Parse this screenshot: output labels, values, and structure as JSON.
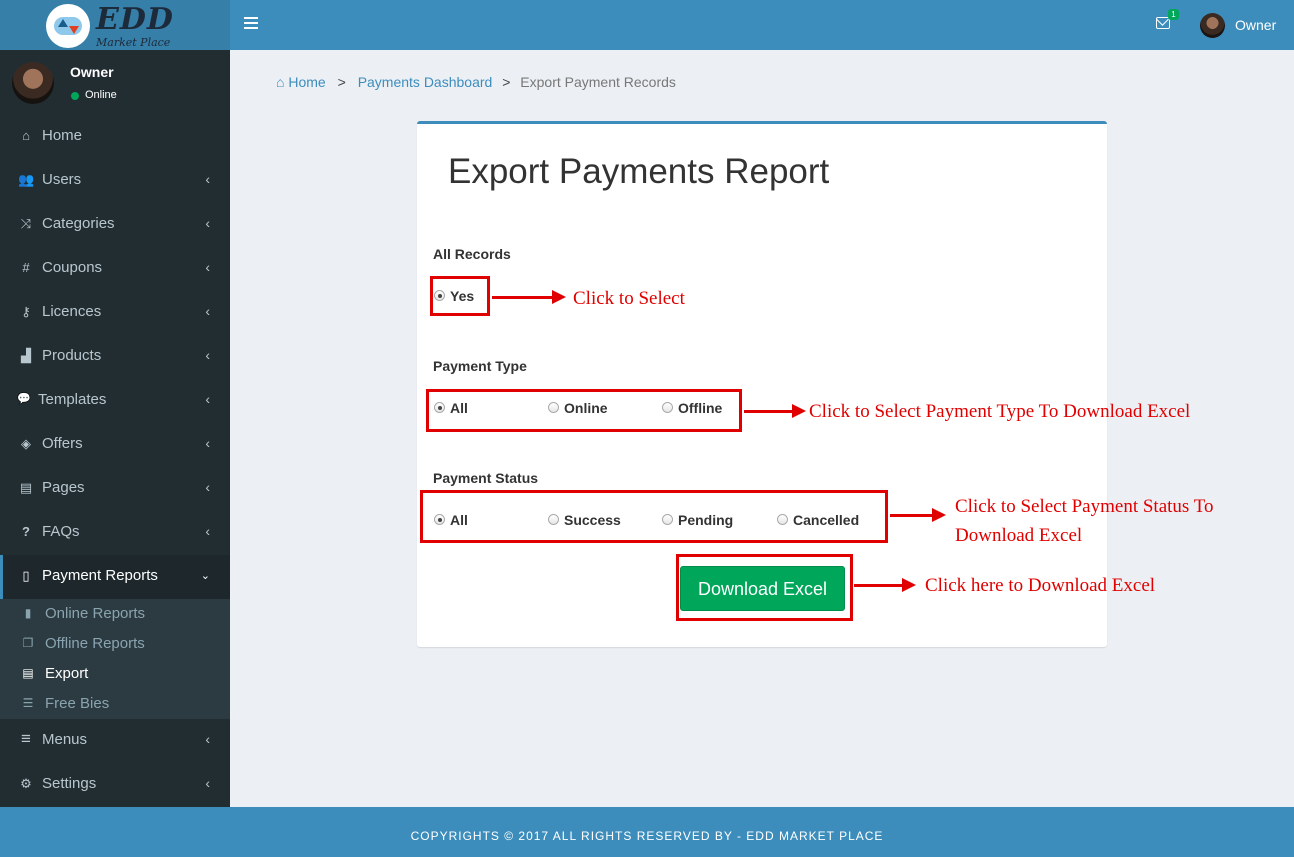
{
  "logo": {
    "title": "EDD",
    "subtitle": "Market Place"
  },
  "header": {
    "mail_count": "1",
    "user_name": "Owner"
  },
  "user_panel": {
    "name": "Owner",
    "status": "Online"
  },
  "sidebar": {
    "items": [
      {
        "label": "Home",
        "icon": "home-icon",
        "glyph": "⌂"
      },
      {
        "label": "Users",
        "icon": "users-icon",
        "glyph": "👥"
      },
      {
        "label": "Categories",
        "icon": "random-icon",
        "glyph": "⤨"
      },
      {
        "label": "Coupons",
        "icon": "hashtag-icon",
        "glyph": "#"
      },
      {
        "label": "Licences",
        "icon": "key-icon",
        "glyph": "⚷"
      },
      {
        "label": "Products",
        "icon": "shopping-bag-icon",
        "glyph": "▟"
      },
      {
        "label": "Templates",
        "icon": "comment-icon",
        "glyph": "💬"
      },
      {
        "label": "Offers",
        "icon": "tags-icon",
        "glyph": "◈"
      },
      {
        "label": "Pages",
        "icon": "file-text-icon",
        "glyph": "▤"
      },
      {
        "label": "FAQs",
        "icon": "question-icon",
        "glyph": "?"
      },
      {
        "label": "Payment Reports",
        "icon": "file-icon",
        "glyph": "▯"
      },
      {
        "label": "Menus",
        "icon": "bars-icon",
        "glyph": "≡"
      },
      {
        "label": "Settings",
        "icon": "gear-icon",
        "glyph": "⚙"
      }
    ],
    "submenu": [
      {
        "label": "Online Reports",
        "icon": "file-icon"
      },
      {
        "label": "Offline Reports",
        "icon": "copy-icon"
      },
      {
        "label": "Export",
        "icon": "file-text-icon"
      },
      {
        "label": "Free Bies",
        "icon": "list-alt-icon"
      }
    ]
  },
  "breadcrumb": {
    "home": "Home",
    "sep": ">",
    "dashboard": "Payments Dashboard",
    "current": "Export Payment Records"
  },
  "card": {
    "title": "Export Payments Report",
    "all_records": {
      "label": "All Records",
      "options": [
        "Yes"
      ],
      "selected": "Yes"
    },
    "payment_type": {
      "label": "Payment Type",
      "options": [
        "All",
        "Online",
        "Offline"
      ],
      "selected": "All"
    },
    "payment_status": {
      "label": "Payment Status",
      "options": [
        "All",
        "Success",
        "Pending",
        "Cancelled"
      ],
      "selected": "All"
    },
    "download_label": "Download Excel"
  },
  "annotations": {
    "select": "Click to Select",
    "payment_type": "Click to Select Payment Type To Download Excel",
    "payment_status_line1": "Click to Select Payment Status To",
    "payment_status_line2": "Download Excel",
    "download": "Click here to Download Excel"
  },
  "footer": {
    "text": "COPYRIGHTS © 2017 ALL RIGHTS RESERVED BY - EDD MARKET PLACE"
  },
  "colors": {
    "primary": "#3c8dbc",
    "sidebar": "#222d32",
    "success": "#00a65a",
    "annotation": "#e00000"
  }
}
